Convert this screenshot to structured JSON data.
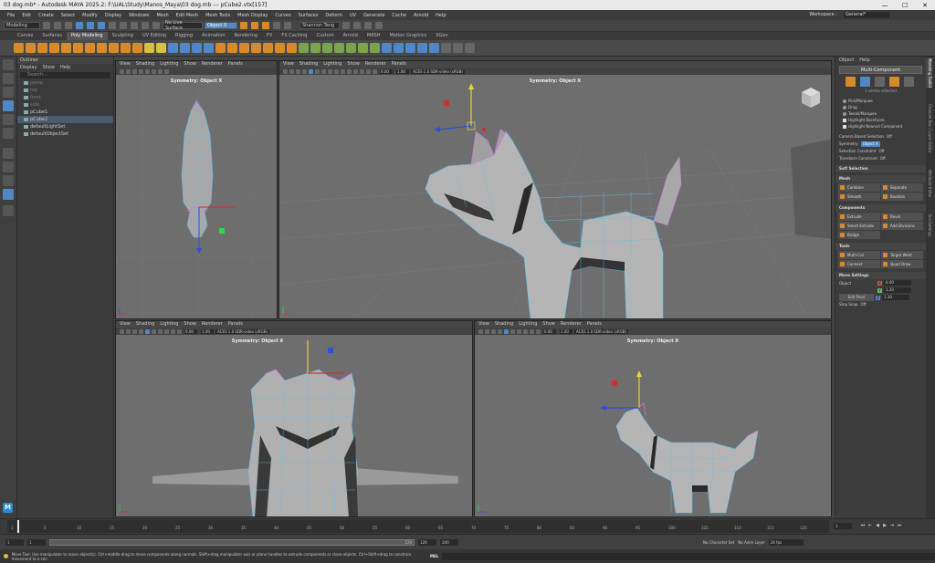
{
  "window": {
    "title": "03 dog.mb* - Autodesk MAYA 2025.2: F:\\UAL\\Study\\Manos_Maya\\03 dog.mb  ---  pCube2.vtx[157]",
    "minimize": "—",
    "maximize": "☐",
    "close": "✕"
  },
  "menu": {
    "items": [
      "File",
      "Edit",
      "Create",
      "Select",
      "Modify",
      "Display",
      "Windows",
      "Mesh",
      "Edit Mesh",
      "Mesh Tools",
      "Mesh Display",
      "Curves",
      "Surfaces",
      "Deform",
      "UV",
      "Generate",
      "Cache",
      "Arnold",
      "Help"
    ],
    "workspace_label": "Workspace :",
    "workspace_value": "General*"
  },
  "statusline": {
    "mode": "Modeling",
    "live_surface": "No Live Surface",
    "symmetry": "Object X",
    "user": "Shannon Tang"
  },
  "shelf": {
    "tabs": [
      "Curves",
      "Surfaces",
      "Poly Modeling",
      "Sculpting",
      "UV Editing",
      "Rigging",
      "Animation",
      "Rendering",
      "FX",
      "FX Caching",
      "Custom",
      "Arnold",
      "MASH",
      "Motion Graphics",
      "XGen"
    ],
    "active_tab": "Poly Modeling"
  },
  "outliner": {
    "title": "Outliner",
    "menu": [
      "Display",
      "Show",
      "Help"
    ],
    "search": "Search...",
    "items": [
      {
        "label": "persp",
        "dim": true
      },
      {
        "label": "top",
        "dim": true
      },
      {
        "label": "front",
        "dim": true
      },
      {
        "label": "side",
        "dim": true
      },
      {
        "label": "pCube1",
        "dim": false
      },
      {
        "label": "pCube2",
        "dim": false,
        "selected": true
      },
      {
        "label": "defaultLightSet",
        "dim": false
      },
      {
        "label": "defaultObjectSet",
        "dim": false
      }
    ]
  },
  "viewport": {
    "menu": [
      "View",
      "Shading",
      "Lighting",
      "Show",
      "Renderer",
      "Panels"
    ],
    "near": "0.00",
    "far": "1.00",
    "aces": "ACES 1.0 SDR-video (sRGB)",
    "symmetry_label": "Symmetry: Object X"
  },
  "rightpanel": {
    "menu": [
      "Object",
      "Help"
    ],
    "multi_component": "Multi-Component",
    "vertex_selected": "1 vertex selected",
    "options": [
      {
        "label": "Pick/Marquee",
        "type": "radio"
      },
      {
        "label": "Drag",
        "type": "radio"
      },
      {
        "label": "Tweak/Marquee",
        "type": "radio"
      },
      {
        "label": "Highlight Backfaces",
        "type": "check"
      },
      {
        "label": "Highlight Nearest Component",
        "type": "check"
      }
    ],
    "camera_sel_label": "Camera Based Selection",
    "camera_sel_value": "Off",
    "symmetry_label": "Symmetry",
    "symmetry_value": "Object X",
    "sel_constraint_label": "Selection Constraint",
    "sel_constraint_value": "Off",
    "transform_constraint_label": "Transform Constraint",
    "transform_constraint_value": "Off",
    "soft_selection": "Soft Selection",
    "mesh_header": "Mesh",
    "mesh_buttons": [
      "Combine",
      "Separate",
      "Smooth",
      "Boolean"
    ],
    "components_header": "Components",
    "components_buttons": [
      "Extrude",
      "Bevel",
      "Smart Extrude",
      "Add Divisions",
      "Bridge"
    ],
    "tools_header": "Tools",
    "tools_buttons": [
      "Multi-Cut",
      "Target Weld",
      "Connect",
      "Quad Draw"
    ],
    "move_header": "Move Settings",
    "move_space": "Object",
    "xyz": {
      "x": "0.00",
      "y": "1.20",
      "z": "1.30"
    },
    "edit_pivot": "Edit Pivot",
    "step_snap_label": "Step Snap",
    "step_snap_value": "Off"
  },
  "sidetabs": [
    "Modeling Toolkit",
    "Channel Box / Layer Editor",
    "Attribute Editor",
    "Tool Settings"
  ],
  "timeslider": {
    "ticks": [
      "1",
      "5",
      "10",
      "15",
      "20",
      "25",
      "30",
      "35",
      "40",
      "45",
      "50",
      "55",
      "60",
      "65",
      "70",
      "75",
      "80",
      "85",
      "90",
      "95",
      "100",
      "105",
      "110",
      "115",
      "120"
    ],
    "current_frame": "1",
    "playback": [
      "⏮",
      "⇤",
      "◀",
      "▶",
      "⇥",
      "⏭"
    ]
  },
  "rangeslider": {
    "start": "1",
    "inner_start": "1",
    "inner_end": "120",
    "end": "120",
    "max": "200",
    "character_set": "No Character Set",
    "anim_layer": "No Anim Layer",
    "fps": "24 fps"
  },
  "helpline": {
    "text": "Move Tool: Use manipulator to move object(s). Ctrl+middle-drag to move components along normals. Shift+drag manipulator axis or plane handles to extrude components or clone objects. Ctrl+Shift+drag to constrain movement to a con",
    "mel": "MEL"
  },
  "logo": "M"
}
